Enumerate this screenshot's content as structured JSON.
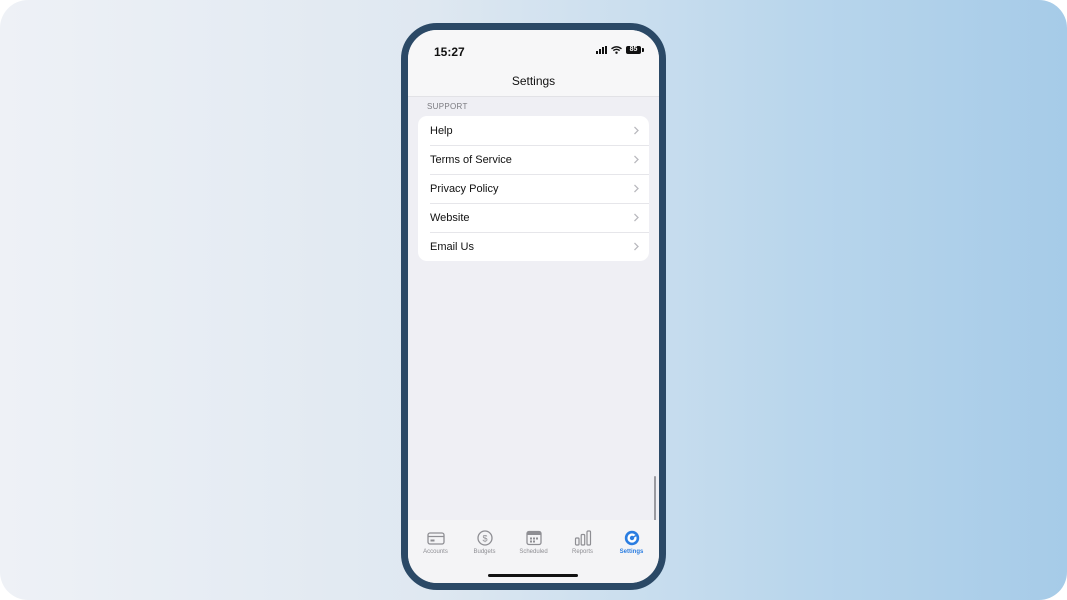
{
  "status_bar": {
    "time": "15:27",
    "battery": "85"
  },
  "nav": {
    "title": "Settings"
  },
  "support_section": {
    "header": "SUPPORT",
    "items": [
      {
        "label": "Help"
      },
      {
        "label": "Terms of Service"
      },
      {
        "label": "Privacy Policy"
      },
      {
        "label": "Website"
      },
      {
        "label": "Email Us"
      }
    ]
  },
  "tab_bar": {
    "tabs": [
      {
        "label": "Accounts",
        "icon": "credit-card-icon"
      },
      {
        "label": "Budgets",
        "icon": "dollar-circle-icon"
      },
      {
        "label": "Scheduled",
        "icon": "calendar-icon"
      },
      {
        "label": "Reports",
        "icon": "bar-chart-icon"
      },
      {
        "label": "Settings",
        "icon": "settings-icon"
      }
    ],
    "active": "Settings"
  },
  "colors": {
    "frame": "#2b4966",
    "accent": "#2a7de1",
    "background": "#efeff4"
  }
}
